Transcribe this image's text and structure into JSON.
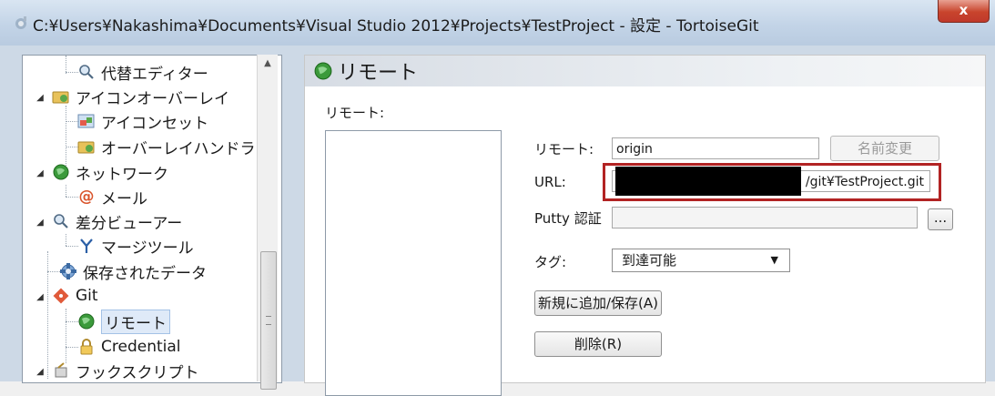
{
  "window": {
    "title": "C:¥Users¥Nakashima¥Documents¥Visual Studio 2012¥Projects¥TestProject - 設定 - TortoiseGit",
    "close_label": "x"
  },
  "tree": {
    "items": [
      {
        "label": "代替エディター",
        "icon": "magnifier-icon"
      },
      {
        "label": "アイコンオーバーレイ",
        "icon": "overlay-folder-icon"
      },
      {
        "label": "アイコンセット",
        "icon": "icon-set-icon"
      },
      {
        "label": "オーバーレイハンドラー",
        "icon": "overlay-handler-icon"
      },
      {
        "label": "ネットワーク",
        "icon": "network-globe-icon"
      },
      {
        "label": "メール",
        "icon": "mail-at-icon"
      },
      {
        "label": "差分ビューアー",
        "icon": "diff-magnifier-icon"
      },
      {
        "label": "マージツール",
        "icon": "merge-icon"
      },
      {
        "label": "保存されたデータ",
        "icon": "saved-data-icon"
      },
      {
        "label": "Git",
        "icon": "git-icon"
      },
      {
        "label": "リモート",
        "icon": "remote-globe-icon",
        "selected": true
      },
      {
        "label": "Credential",
        "icon": "lock-icon"
      },
      {
        "label": "フックスクリプト",
        "icon": "hook-script-icon"
      }
    ]
  },
  "panel": {
    "title": "リモート",
    "remote_list_label": "リモート:",
    "remote_field_label": "リモート:",
    "remote_value": "origin",
    "rename_button": "名前変更",
    "url_label": "URL:",
    "url_visible_value": "/git¥TestProject.git",
    "putty_label": "Putty 認証",
    "browse_button": "...",
    "tag_label": "タグ:",
    "tag_value": "到達可能",
    "add_save_button": "新規に追加/保存(A)",
    "delete_button": "削除(R)"
  },
  "colors": {
    "highlight_border": "#b22323",
    "redaction": "#000000"
  }
}
